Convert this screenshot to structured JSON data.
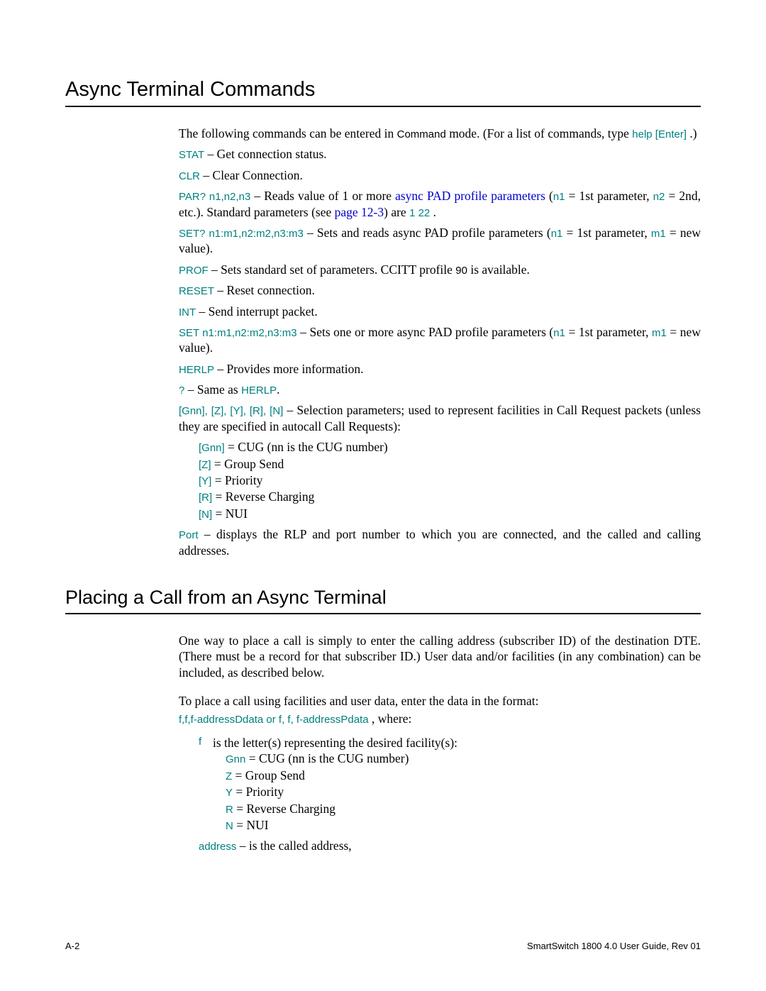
{
  "heading1": "Async Terminal Commands",
  "intro_a": "The following commands can be entered in ",
  "intro_b": "Command",
  "intro_c": " mode. (For a list of commands, type ",
  "intro_help": "help [Enter]",
  "intro_d": " .)",
  "stat_cmd": "STAT",
  "stat_txt": " – Get connection status.",
  "clr_cmd": "CLR",
  "clr_txt": " – Clear Connection.",
  "par_cmd": "PAR? n1,n2,n3",
  "par_a": " – Reads value of 1 or more ",
  "par_link": "async PAD profile parameters",
  "par_b": " (",
  "par_n1": "n1",
  "par_c": " = 1st parameter, ",
  "par_n2": "n2",
  "par_d": " = 2nd, etc.). Standard parameters (see ",
  "par_page": "page 12-3",
  "par_e": ") are ",
  "par_122": "1 22",
  "par_f": " .",
  "setq_cmd": "SET? n1:m1,n2:m2,n3:m3",
  "setq_a": " – Sets and reads async PAD profile parameters (",
  "setq_n1": "n1",
  "setq_b": " = 1st parameter, ",
  "setq_m1": "m1",
  "setq_c": " = new value).",
  "prof_cmd": "PROF",
  "prof_a": " – Sets standard set of parameters. CCITT profile ",
  "prof_90": "90",
  "prof_b": " is available.",
  "reset_cmd": "RESET",
  "reset_txt": " – Reset connection.",
  "int_cmd": "INT",
  "int_txt": " – Send interrupt packet.",
  "set_cmd": "SET n1:m1,n2:m2,n3:m3",
  "set_a": " – Sets one or more async PAD profile parameters (",
  "set_n1": "n1",
  "set_b": " = 1st parameter, ",
  "set_m1": "m1",
  "set_c": " = new value).",
  "herlp_cmd": "HERLP",
  "herlp_txt": " – Provides more information.",
  "q_cmd": "?",
  "q_a": " – Same as ",
  "q_herlp": "HERLP",
  "q_b": ".",
  "sel_cmd": "[Gnn], [Z], [Y], [R], [N]",
  "sel_txt": " – Selection parameters; used to represent facilities in Call Request packets (unless they are specified in autocall Call Requests):",
  "sel_g_k": "[Gnn]",
  "sel_g_v": " = CUG (nn is the CUG number)",
  "sel_z_k": "[Z]",
  "sel_z_v": " = Group Send",
  "sel_y_k": "[Y]",
  "sel_y_v": " = Priority",
  "sel_r_k": "[R]",
  "sel_r_v": " = Reverse Charging",
  "sel_n_k": "[N]",
  "sel_n_v": " = NUI",
  "port_cmd": "Port",
  "port_txt": " – displays the RLP and port number to which you are connected, and the called and calling addresses.",
  "heading2": "Placing a Call from an Async Terminal",
  "p2a": "One way to place a call is simply to enter the calling address (subscriber ID) of the destination DTE. (There must be a record for that subscriber ID.) User data and/or facilities (in any combination) can be included, as described below.",
  "p2b": "To place a call using facilities and user data, enter the data in the format:",
  "p2fmt": "f,f,f-addressDdata or f, f, f-addressPdata",
  "p2where": " , where:",
  "f_key": "f",
  "f_txt": "is the letter(s) representing the desired facility(s):",
  "f_g_k": "Gnn",
  "f_g_v": " = CUG (nn is the CUG number)",
  "f_z_k": "Z",
  "f_z_v": " = Group Send",
  "f_y_k": "Y",
  "f_y_v": " = Priority",
  "f_r_k": "R",
  "f_r_v": " = Reverse Charging",
  "f_n_k": "N",
  "f_n_v": " = NUI",
  "addr_k": "address",
  "addr_v": " – is the called address,",
  "footer_left": "A-2",
  "footer_right": "SmartSwitch 1800 4.0 User Guide, Rev 01"
}
